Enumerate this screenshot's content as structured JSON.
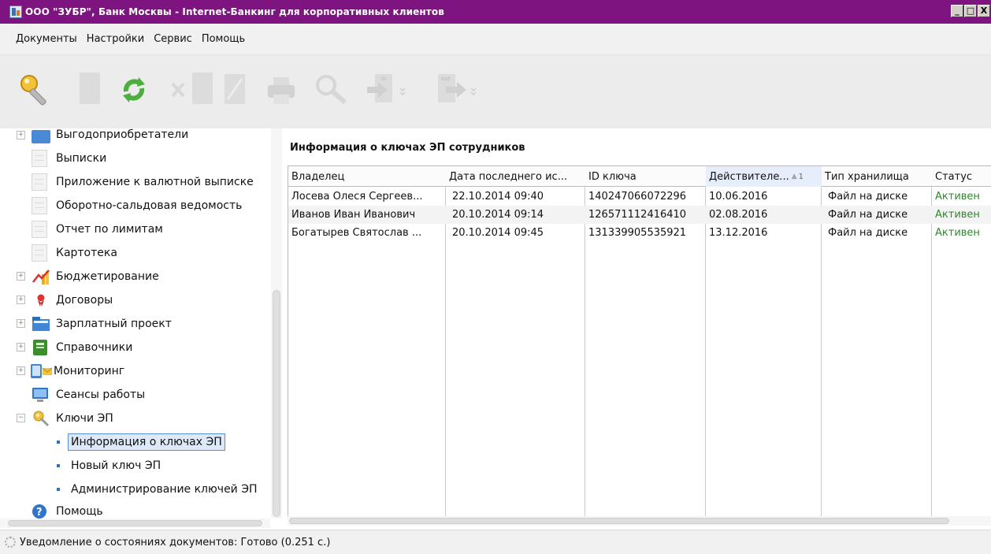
{
  "window": {
    "title": "ООО \"ЗУБР\", Банк Москвы - Internet-Банкинг для корпоративных клиентов",
    "minimize": "_",
    "maximize": "□",
    "close": "X"
  },
  "menu": [
    "Документы",
    "Настройки",
    "Сервис",
    "Помощь"
  ],
  "toolbar": [
    {
      "name": "key-icon"
    },
    {
      "name": "new-document-icon"
    },
    {
      "name": "refresh-icon"
    },
    {
      "name": "delete-icon"
    },
    {
      "name": "copy-icon"
    },
    {
      "name": "edit-icon"
    },
    {
      "name": "print-icon"
    },
    {
      "name": "search-icon"
    },
    {
      "name": "import-icon",
      "badge": "in"
    },
    {
      "name": "export-icon",
      "badge": "out"
    }
  ],
  "sidebar": {
    "items": [
      {
        "label": "Выгодоприобретатели",
        "type": "folder"
      },
      {
        "label": "Выписки",
        "type": "page"
      },
      {
        "label": "Приложение к валютной выписке",
        "type": "page"
      },
      {
        "label": "Оборотно-сальдовая ведомость",
        "type": "page"
      },
      {
        "label": "Отчет по лимитам",
        "type": "page"
      },
      {
        "label": "Картотека",
        "type": "page"
      },
      {
        "label": "Бюджетирование",
        "type": "group",
        "icon": "chart-icon"
      },
      {
        "label": "Договоры",
        "type": "group",
        "icon": "ribbon-icon"
      },
      {
        "label": "Зарплатный проект",
        "type": "group",
        "icon": "folder-icon"
      },
      {
        "label": "Справочники",
        "type": "group",
        "icon": "book-icon"
      },
      {
        "label": "Мониторинг",
        "type": "group",
        "icon": "monitoring-icon"
      },
      {
        "label": "Сеансы работы",
        "type": "leaf",
        "icon": "monitor-icon"
      },
      {
        "label": "Ключи ЭП",
        "type": "group-open",
        "icon": "keys-icon"
      },
      {
        "label": "Информация о ключах ЭП",
        "type": "sub",
        "selected": true
      },
      {
        "label": "Новый ключ ЭП",
        "type": "sub"
      },
      {
        "label": "Администрирование ключей ЭП",
        "type": "sub"
      },
      {
        "label": "Помощь",
        "type": "leaf",
        "icon": "help-icon"
      }
    ]
  },
  "content": {
    "title": "Информация о ключах ЭП сотрудников",
    "columns": [
      "Владелец",
      "Дата последнего ис...",
      "ID ключа",
      "Действителе...",
      "Тип хранилища",
      "Статус"
    ],
    "sort_index": "1",
    "rows": [
      [
        "Лосева Олеся Сергеев...",
        "22.10.2014 09:40",
        "140247066072296",
        "10.06.2016",
        "Файл на диске",
        "Активен"
      ],
      [
        "Иванов Иван Иванович",
        "20.10.2014 09:14",
        "126571112416410",
        "02.08.2016",
        "Файл на диске",
        "Активен"
      ],
      [
        "Богатырев Святослав ...",
        "20.10.2014 09:45",
        "131339905535921",
        "13.12.2016",
        "Файл на диске",
        "Активен"
      ]
    ]
  },
  "status": {
    "text": "Уведомление о состояниях документов: Готово (0.251 с.)"
  },
  "colors": {
    "titlebar": "#7d1480",
    "status_active": "#2c8a2c",
    "selection_border": "#5a8fd6"
  }
}
